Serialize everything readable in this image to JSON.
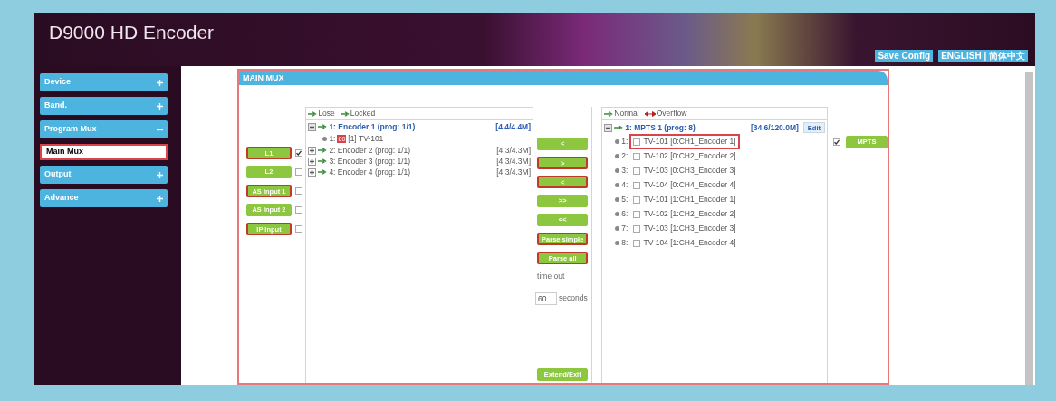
{
  "header": {
    "title": "D9000 HD Encoder",
    "buttons": [
      "Save Config",
      "ENGLISH | 简体中文"
    ]
  },
  "sidebar": {
    "items": [
      {
        "label": "Device",
        "kind": "group",
        "expanded": false,
        "selected": false
      },
      {
        "label": "Band.",
        "kind": "group",
        "expanded": false,
        "selected": false
      },
      {
        "label": "Program Mux",
        "kind": "group",
        "expanded": true,
        "selected": false
      },
      {
        "label": "Main Mux",
        "kind": "sub",
        "selected": true
      },
      {
        "label": "Output",
        "kind": "group",
        "expanded": false,
        "selected": false
      },
      {
        "label": "Advance",
        "kind": "group",
        "expanded": false,
        "selected": false
      }
    ]
  },
  "panel": {
    "title": "MAIN MUX",
    "inputs": [
      {
        "label": "L1",
        "highlighted": true,
        "checked": true
      },
      {
        "label": "L2",
        "highlighted": false,
        "checked": false
      },
      {
        "label": "AS Input 1",
        "highlighted": true,
        "checked": false
      },
      {
        "label": "AS Input 2",
        "highlighted": false,
        "checked": false
      },
      {
        "label": "IP Input",
        "highlighted": true,
        "checked": false
      }
    ],
    "source_tree": {
      "legend": [
        "Lose",
        "Locked"
      ],
      "nodes": [
        {
          "label": "1: Encoder 1 (prog: 1/1)",
          "rate": "[4.4/4.4M]",
          "expanded": true,
          "active": true,
          "children": [
            {
              "index": "1:",
              "badge": "60",
              "label": "[1] TV-101"
            }
          ]
        },
        {
          "label": "2: Encoder 2 (prog: 1/1)",
          "rate": "[4.3/4.3M]",
          "expanded": false,
          "active": false
        },
        {
          "label": "3: Encoder 3 (prog: 1/1)",
          "rate": "[4.3/4.3M]",
          "expanded": false,
          "active": false
        },
        {
          "label": "4: Encoder 4 (prog: 1/1)",
          "rate": "[4.3/4.3M]",
          "expanded": false,
          "active": false
        }
      ]
    },
    "actions": [
      {
        "label": "<",
        "highlighted": false
      },
      {
        "label": ">",
        "highlighted": true
      },
      {
        "label": "<",
        "highlighted": true
      },
      {
        "label": ">>",
        "highlighted": false
      },
      {
        "label": "<<",
        "highlighted": false
      },
      {
        "label": "Parse simple",
        "highlighted": true
      },
      {
        "label": "Parse all",
        "highlighted": true
      }
    ],
    "timeout": {
      "label": "time out",
      "value": "60",
      "unit": "seconds"
    },
    "exit_button": "Extend/Exit",
    "output_tree": {
      "legend": [
        "Normal",
        "Overflow"
      ],
      "nodes": [
        {
          "label": "1: MPTS 1 (prog: 8)",
          "rate": "[34.6/120.0M]",
          "edit": "Edit",
          "expanded": true,
          "children": [
            {
              "index": "1:",
              "label": "TV-101 [0:CH1_Encoder 1]",
              "highlighted": true,
              "checked": false
            },
            {
              "index": "2:",
              "label": "TV-102 [0:CH2_Encoder 2]",
              "highlighted": false,
              "checked": false
            },
            {
              "index": "3:",
              "label": "TV-103 [0:CH3_Encoder 3]",
              "highlighted": false,
              "checked": false
            },
            {
              "index": "4:",
              "label": "TV-104 [0:CH4_Encoder 4]",
              "highlighted": false,
              "checked": false
            },
            {
              "index": "5:",
              "label": "TV-101 [1:CH1_Encoder 1]",
              "highlighted": false,
              "checked": false
            },
            {
              "index": "6:",
              "label": "TV-102 [1:CH2_Encoder 2]",
              "highlighted": false,
              "checked": false
            },
            {
              "index": "7:",
              "label": "TV-103 [1:CH3_Encoder 3]",
              "highlighted": false,
              "checked": false
            },
            {
              "index": "8:",
              "label": "TV-104 [1:CH4_Encoder 4]",
              "highlighted": false,
              "checked": false
            }
          ]
        }
      ]
    },
    "outputs": [
      {
        "label": "MPTS",
        "checked": true
      }
    ]
  }
}
